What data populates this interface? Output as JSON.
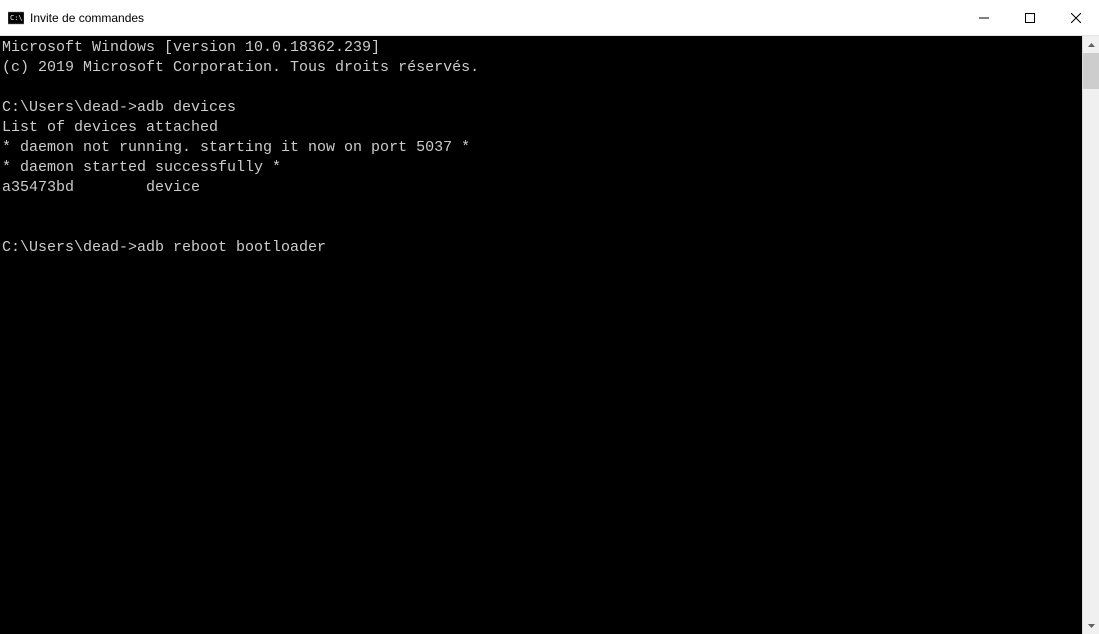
{
  "window": {
    "title": "Invite de commandes"
  },
  "terminal": {
    "lines": [
      "Microsoft Windows [version 10.0.18362.239]",
      "(c) 2019 Microsoft Corporation. Tous droits réservés.",
      "",
      "C:\\Users\\dead->adb devices",
      "List of devices attached",
      "* daemon not running. starting it now on port 5037 *",
      "* daemon started successfully *",
      "a35473bd        device",
      "",
      "",
      "C:\\Users\\dead->adb reboot bootloader"
    ]
  }
}
